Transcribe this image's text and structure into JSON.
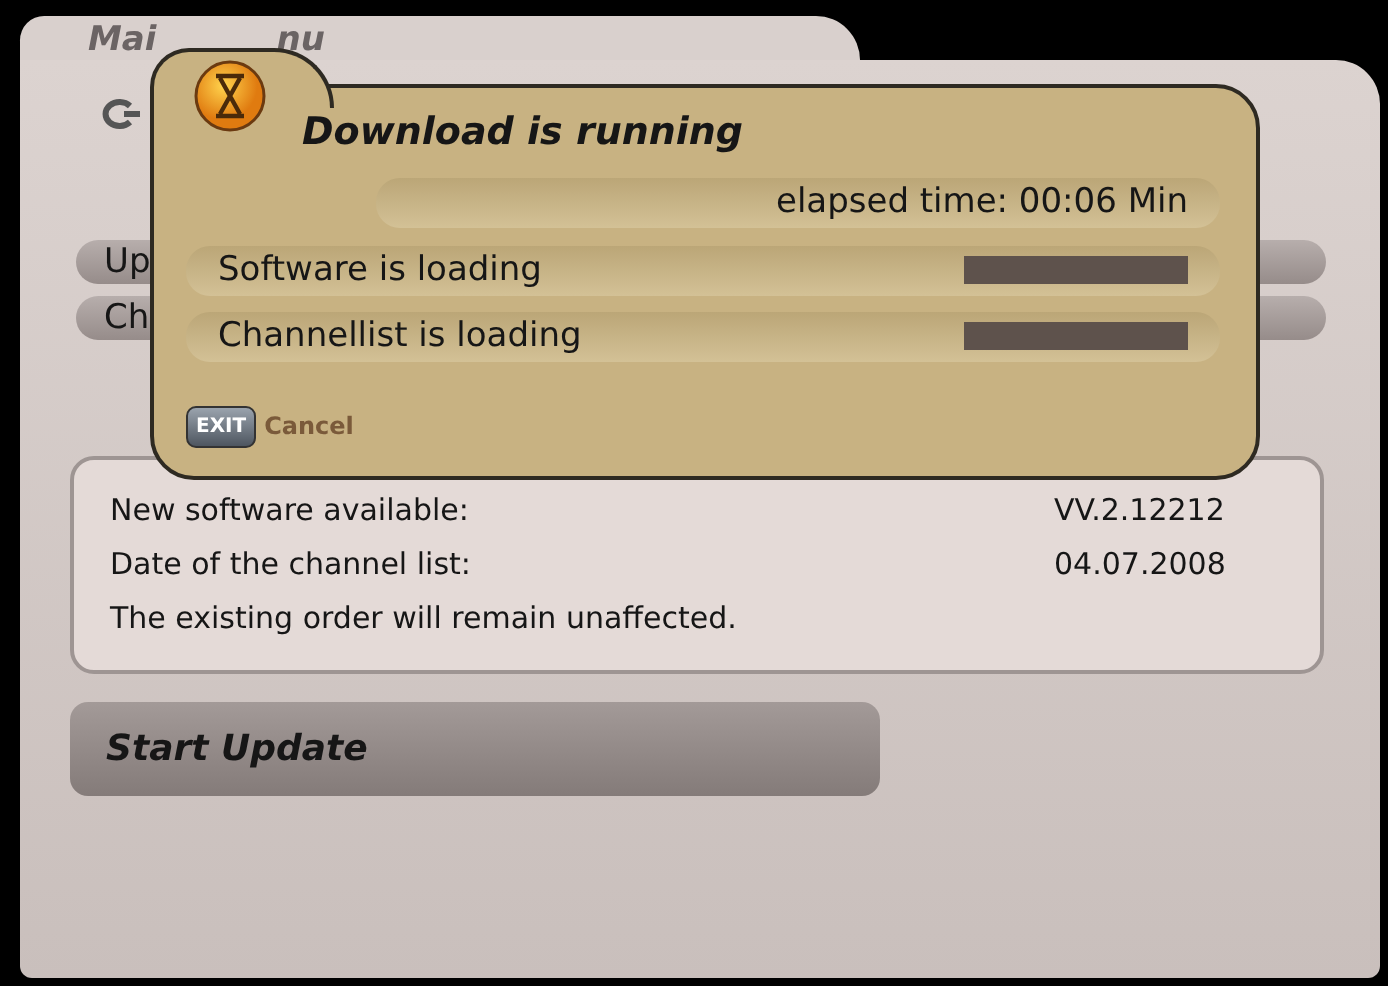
{
  "main_menu": {
    "title_parts": [
      "Mai",
      "nu"
    ],
    "items": [
      {
        "label": "Up"
      },
      {
        "label": "Ch"
      }
    ]
  },
  "info": [
    {
      "label": "New software available:",
      "value": "VV.2.12212"
    },
    {
      "label": "Date of the channel list:",
      "value": "04.07.2008"
    },
    {
      "label": "The existing order will remain unaffected."
    }
  ],
  "start_button": "Start Update",
  "dialog": {
    "title": "Download is running",
    "elapsed": "elapsed time: 00:06 Min",
    "tasks": [
      {
        "label": "Software is loading",
        "level": 1
      },
      {
        "label": "Channellist is loading",
        "level": 1
      }
    ],
    "key": "EXIT",
    "cancel": "Cancel"
  }
}
